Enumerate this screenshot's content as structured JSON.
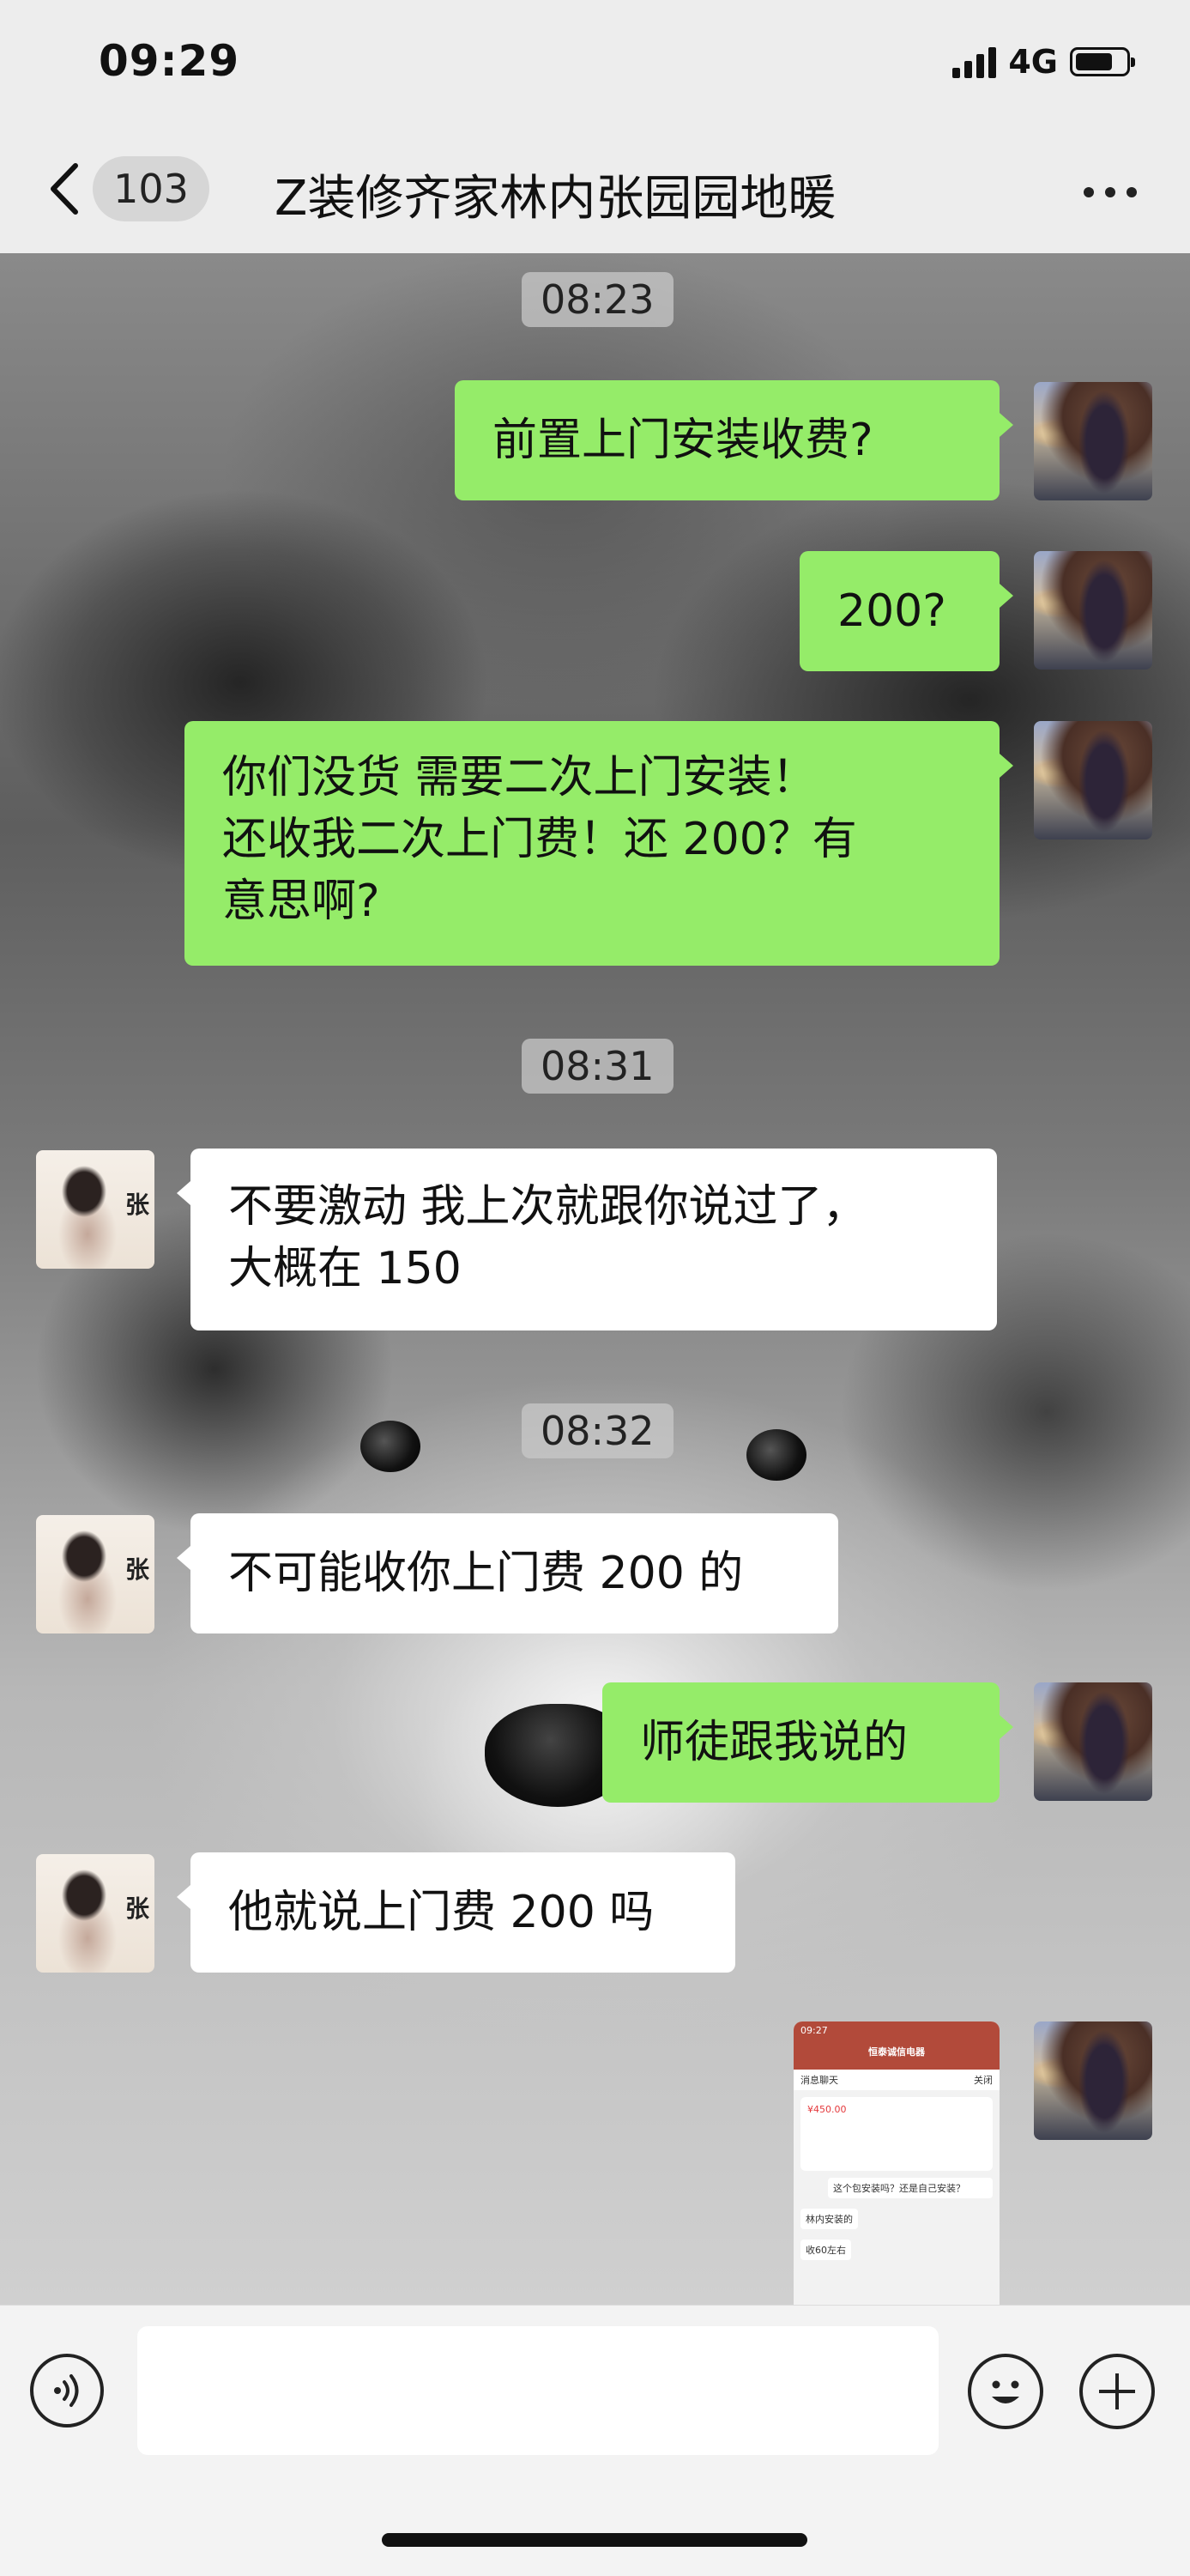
{
  "status_bar": {
    "time": "09:29",
    "network": "4G"
  },
  "header": {
    "unread_count": "103",
    "title": "Z装修齐家林内张园园地暖"
  },
  "messages": [
    {
      "type": "time",
      "text": "08:23"
    },
    {
      "type": "me",
      "lines": [
        "前置上门安装收费?"
      ]
    },
    {
      "type": "me",
      "lines": [
        "200?"
      ]
    },
    {
      "type": "me",
      "lines": [
        "你们没货 需要二次上门安装！",
        "还收我二次上门费！还 200？有",
        "意思啊?"
      ]
    },
    {
      "type": "time",
      "text": "08:31"
    },
    {
      "type": "other",
      "avatar_char": "张",
      "lines": [
        "不要激动 我上次就跟你说过了，",
        "大概在 150"
      ]
    },
    {
      "type": "time",
      "text": "08:32"
    },
    {
      "type": "other",
      "avatar_char": "张",
      "lines": [
        "不可能收你上门费 200 的"
      ]
    },
    {
      "type": "me",
      "lines": [
        "师徒跟我说的"
      ]
    },
    {
      "type": "other",
      "avatar_char": "张",
      "lines": [
        "他就说上门费 200 吗"
      ]
    },
    {
      "type": "me-image",
      "caption": "shared screenshot"
    }
  ],
  "shared_screenshot": {
    "time": "09:27",
    "left_label": "消息聊天",
    "title": "恒泰诚信电器",
    "right_label": "关闭",
    "price": "¥450.00",
    "question": "这个包安装吗？还是自己安装？",
    "reply_1": "林内安装的",
    "reply_2": "收60左右"
  },
  "input_bar": {
    "placeholder": ""
  },
  "icons": {
    "back": "chevron-left-icon",
    "more": "more-dots-icon",
    "voice": "voice-icon",
    "emoji": "emoji-icon",
    "plus": "plus-icon"
  },
  "colors": {
    "my_bubble": "#95ec69",
    "other_bubble": "#ffffff",
    "bar_bg": "#ededed"
  }
}
